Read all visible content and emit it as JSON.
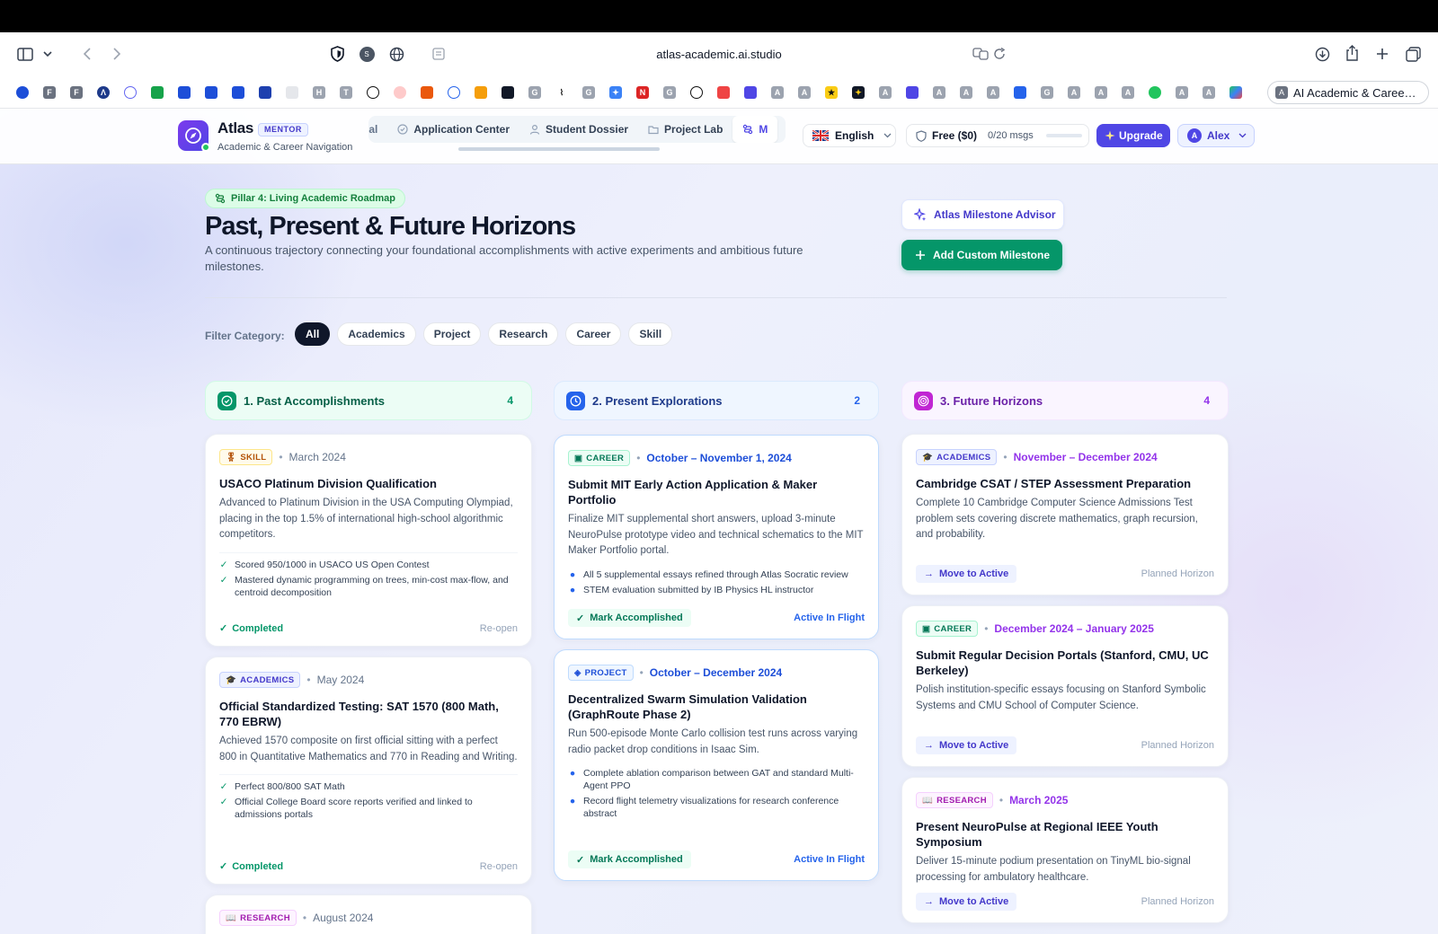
{
  "browser": {
    "url": "atlas-academic.ai.studio",
    "active_tab_label": "AI Academic & Caree…"
  },
  "header": {
    "brand": "Atlas",
    "badge": "MENTOR",
    "subtitle": "Academic & Career Navigation",
    "nav": [
      {
        "label": "bal"
      },
      {
        "label": "Application Center"
      },
      {
        "label": "Student Dossier"
      },
      {
        "label": "Project Lab"
      },
      {
        "label": "M"
      }
    ],
    "language": "English",
    "plan": "Free ($0)",
    "msgs": "0/20 msgs",
    "upgrade": "Upgrade",
    "user": "Alex",
    "user_initial": "A"
  },
  "hero": {
    "pill": "Pillar 4: Living Academic Roadmap",
    "title": "Past, Present & Future Horizons",
    "subtitle": "A continuous trajectory connecting your foundational accomplishments with active experiments and ambitious future milestones.",
    "advisor_button": "Atlas Milestone Advisor",
    "add_button": "Add Custom Milestone"
  },
  "filter": {
    "label": "Filter Category:",
    "chips": [
      "All",
      "Academics",
      "Project",
      "Research",
      "Career",
      "Skill"
    ],
    "selected": "All"
  },
  "columns": [
    {
      "title": "1. Past Accomplishments",
      "count": "4",
      "cards": [
        {
          "tag": "SKILL",
          "date": "March 2024",
          "title": "USACO Platinum Division Qualification",
          "desc": "Advanced to Platinum Division in the USA Computing Olympiad, placing in the top 1.5% of international high-school algorithmic competitors.",
          "bullets": [
            "Scored 950/1000 in USACO US Open Contest",
            "Mastered dynamic programming on trees, min-cost max-flow, and centroid decomposition"
          ],
          "status": "Completed",
          "action": "Re-open"
        },
        {
          "tag": "ACADEMICS",
          "date": "May 2024",
          "title": "Official Standardized Testing: SAT 1570 (800 Math, 770 EBRW)",
          "desc": "Achieved 1570 composite on first official sitting with a perfect 800 in Quantitative Mathematics and 770 in Reading and Writing.",
          "bullets": [
            "Perfect 800/800 SAT Math",
            "Official College Board score reports verified and linked to admissions portals"
          ],
          "status": "Completed",
          "action": "Re-open"
        },
        {
          "tag": "RESEARCH",
          "date": "August 2024"
        }
      ]
    },
    {
      "title": "2. Present Explorations",
      "count": "2",
      "cards": [
        {
          "tag": "CAREER",
          "date": "October – November 1, 2024",
          "title": "Submit MIT Early Action Application & Maker Portfolio",
          "desc": "Finalize MIT supplemental short answers, upload 3-minute NeuroPulse prototype video and technical schematics to the MIT Maker Portfolio portal.",
          "bullets": [
            "All 5 supplemental essays refined through Atlas Socratic review",
            "STEM evaluation submitted by IB Physics HL instructor"
          ],
          "status": "Mark Accomplished",
          "action": "Active In Flight"
        },
        {
          "tag": "PROJECT",
          "date": "October – December 2024",
          "title": "Decentralized Swarm Simulation Validation (GraphRoute Phase 2)",
          "desc": "Run 500-episode Monte Carlo collision test runs across varying radio packet drop conditions in Isaac Sim.",
          "bullets": [
            "Complete ablation comparison between GAT and standard Multi-Agent PPO",
            "Record flight telemetry visualizations for research conference abstract"
          ],
          "status": "Mark Accomplished",
          "action": "Active In Flight"
        }
      ]
    },
    {
      "title": "3. Future Horizons",
      "count": "4",
      "cards": [
        {
          "tag": "ACADEMICS",
          "date": "November – December 2024",
          "title": "Cambridge CSAT / STEP Assessment Preparation",
          "desc": "Complete 10 Cambridge Computer Science Admissions Test problem sets covering discrete mathematics, graph recursion, and probability.",
          "status": "Move to Active",
          "action": "Planned Horizon"
        },
        {
          "tag": "CAREER",
          "date": "December 2024 – January 2025",
          "title": "Submit Regular Decision Portals (Stanford, CMU, UC Berkeley)",
          "desc": "Polish institution-specific essays focusing on Stanford Symbolic Systems and CMU School of Computer Science.",
          "status": "Move to Active",
          "action": "Planned Horizon"
        },
        {
          "tag": "RESEARCH",
          "date": "March 2025",
          "title": "Present NeuroPulse at Regional IEEE Youth Symposium",
          "desc": "Deliver 15-minute podium presentation on TinyML bio-signal processing for ambulatory healthcare.",
          "status": "Move to Active",
          "action": "Planned Horizon"
        }
      ]
    }
  ],
  "colors": {
    "primary": "#4f46e5",
    "success": "#059669",
    "past": "#059669",
    "present": "#2563eb",
    "future": "#9333ea"
  }
}
